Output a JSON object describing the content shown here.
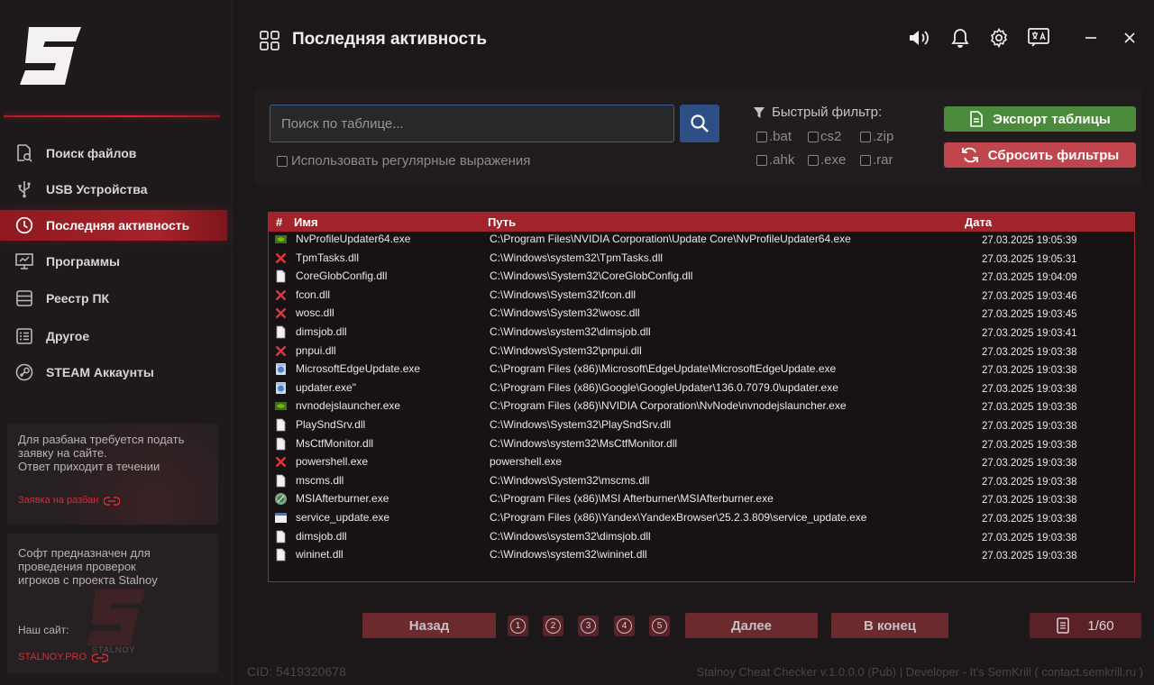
{
  "window": {
    "title": "Последняя активность",
    "buttons": [
      "sound-icon",
      "bell-icon",
      "gear-icon",
      "language-icon",
      "minimize-icon",
      "close-icon"
    ]
  },
  "sidebar": {
    "items": [
      {
        "label": "Поиск файлов",
        "icon": "file-search-icon",
        "active": false
      },
      {
        "label": "USB Устройства",
        "icon": "usb-icon",
        "active": false
      },
      {
        "label": "Последняя активность",
        "icon": "clock-icon",
        "active": true
      },
      {
        "label": "Программы",
        "icon": "monitor-icon",
        "active": false
      },
      {
        "label": "Реестр ПК",
        "icon": "registry-icon",
        "active": false
      },
      {
        "label": "Другое",
        "icon": "list-icon",
        "active": false
      },
      {
        "label": "STEAM Аккаунты",
        "icon": "steam-icon",
        "active": false
      }
    ],
    "card1": {
      "text1": "Для разбана требуется подать заявку на сайте.",
      "text2": "Ответ приходит в течении",
      "link": "Заявка на разбан"
    },
    "card2": {
      "text": "Софт предназначен для проведения проверок игроков с проекта Stalnoy",
      "site_label": "Наш сайт:",
      "link": "STALNOY.PRO",
      "watermark": "STALNOY"
    }
  },
  "search": {
    "placeholder": "Поиск по таблице...",
    "regex_label": "Использовать регулярные выражения"
  },
  "filters": {
    "title": "Быстрый фильтр:",
    "options": [
      ".bat",
      "cs2",
      ".zip",
      ".ahk",
      ".exe",
      ".rar"
    ]
  },
  "actions": {
    "export": "Экспорт таблицы",
    "reset": "Сбросить фильтры"
  },
  "table": {
    "columns": [
      "#",
      "Имя",
      "Путь",
      "Дата"
    ],
    "rows": [
      {
        "icon": "nvidia-icon",
        "name": "NvProfileUpdater64.exe",
        "path": "C:\\Program Files\\NVIDIA Corporation\\Update Core\\NvProfileUpdater64.exe",
        "date": "27.03.2025 19:05:39"
      },
      {
        "icon": "deleted-icon",
        "name": "TpmTasks.dll",
        "path": "C:\\Windows\\system32\\TpmTasks.dll",
        "date": "27.03.2025 19:05:31"
      },
      {
        "icon": "file-icon",
        "name": "CoreGlobConfig.dll",
        "path": "C:\\Windows\\System32\\CoreGlobConfig.dll",
        "date": "27.03.2025 19:04:09"
      },
      {
        "icon": "deleted-icon",
        "name": "fcon.dll",
        "path": "C:\\Windows\\System32\\fcon.dll",
        "date": "27.03.2025 19:03:46"
      },
      {
        "icon": "deleted-icon",
        "name": "wosc.dll",
        "path": "C:\\Windows\\System32\\wosc.dll",
        "date": "27.03.2025 19:03:45"
      },
      {
        "icon": "file-icon",
        "name": "dimsjob.dll",
        "path": "C:\\Windows\\system32\\dimsjob.dll",
        "date": "27.03.2025 19:03:41"
      },
      {
        "icon": "deleted-icon",
        "name": "pnpui.dll",
        "path": "C:\\Windows\\System32\\pnpui.dll",
        "date": "27.03.2025 19:03:38"
      },
      {
        "icon": "installer-icon",
        "name": "MicrosoftEdgeUpdate.exe",
        "path": "C:\\Program Files (x86)\\Microsoft\\EdgeUpdate\\MicrosoftEdgeUpdate.exe",
        "date": "27.03.2025 19:03:38"
      },
      {
        "icon": "installer-icon",
        "name": "updater.exe\"",
        "path": "C:\\Program Files (x86)\\Google\\GoogleUpdater\\136.0.7079.0\\updater.exe",
        "date": "27.03.2025 19:03:38"
      },
      {
        "icon": "nvidia-icon",
        "name": "nvnodejslauncher.exe",
        "path": "C:\\Program Files (x86)\\NVIDIA Corporation\\NvNode\\nvnodejslauncher.exe",
        "date": "27.03.2025 19:03:38"
      },
      {
        "icon": "file-icon",
        "name": "PlaySndSrv.dll",
        "path": "C:\\Windows\\System32\\PlaySndSrv.dll",
        "date": "27.03.2025 19:03:38"
      },
      {
        "icon": "file-icon",
        "name": "MsCtfMonitor.dll",
        "path": "C:\\Windows\\system32\\MsCtfMonitor.dll",
        "date": "27.03.2025 19:03:38"
      },
      {
        "icon": "deleted-icon",
        "name": "powershell.exe",
        "path": "powershell.exe",
        "date": "27.03.2025 19:03:38"
      },
      {
        "icon": "file-icon",
        "name": "mscms.dll",
        "path": "C:\\Windows\\System32\\mscms.dll",
        "date": "27.03.2025 19:03:38"
      },
      {
        "icon": "afterburner-icon",
        "name": "MSIAfterburner.exe",
        "path": "C:\\Program Files (x86)\\MSI Afterburner\\MSIAfterburner.exe",
        "date": "27.03.2025 19:03:38"
      },
      {
        "icon": "window-icon",
        "name": "service_update.exe",
        "path": "C:\\Program Files (x86)\\Yandex\\YandexBrowser\\25.2.3.809\\service_update.exe",
        "date": "27.03.2025 19:03:38"
      },
      {
        "icon": "file-icon",
        "name": "dimsjob.dll",
        "path": "C:\\Windows\\system32\\dimsjob.dll",
        "date": "27.03.2025 19:03:38"
      },
      {
        "icon": "file-icon",
        "name": "wininet.dll",
        "path": "C:\\Windows\\system32\\wininet.dll",
        "date": "27.03.2025 19:03:38"
      }
    ]
  },
  "pagination": {
    "back": "Назад",
    "pages": [
      "1",
      "2",
      "3",
      "4",
      "5"
    ],
    "next": "Далее",
    "end": "В конец",
    "counter": "1/60"
  },
  "footer": {
    "cid": "CID: 5419320678",
    "credit": "Stalnoy Cheat Checker v.1.0.0.0 (Pub) | Developer - It's SemKrill ( contact.semkrill.ru )"
  },
  "colors": {
    "accent": "#a3232a",
    "export": "#4a8a3a",
    "reset": "#c0454c",
    "search": "#2d4f86"
  }
}
